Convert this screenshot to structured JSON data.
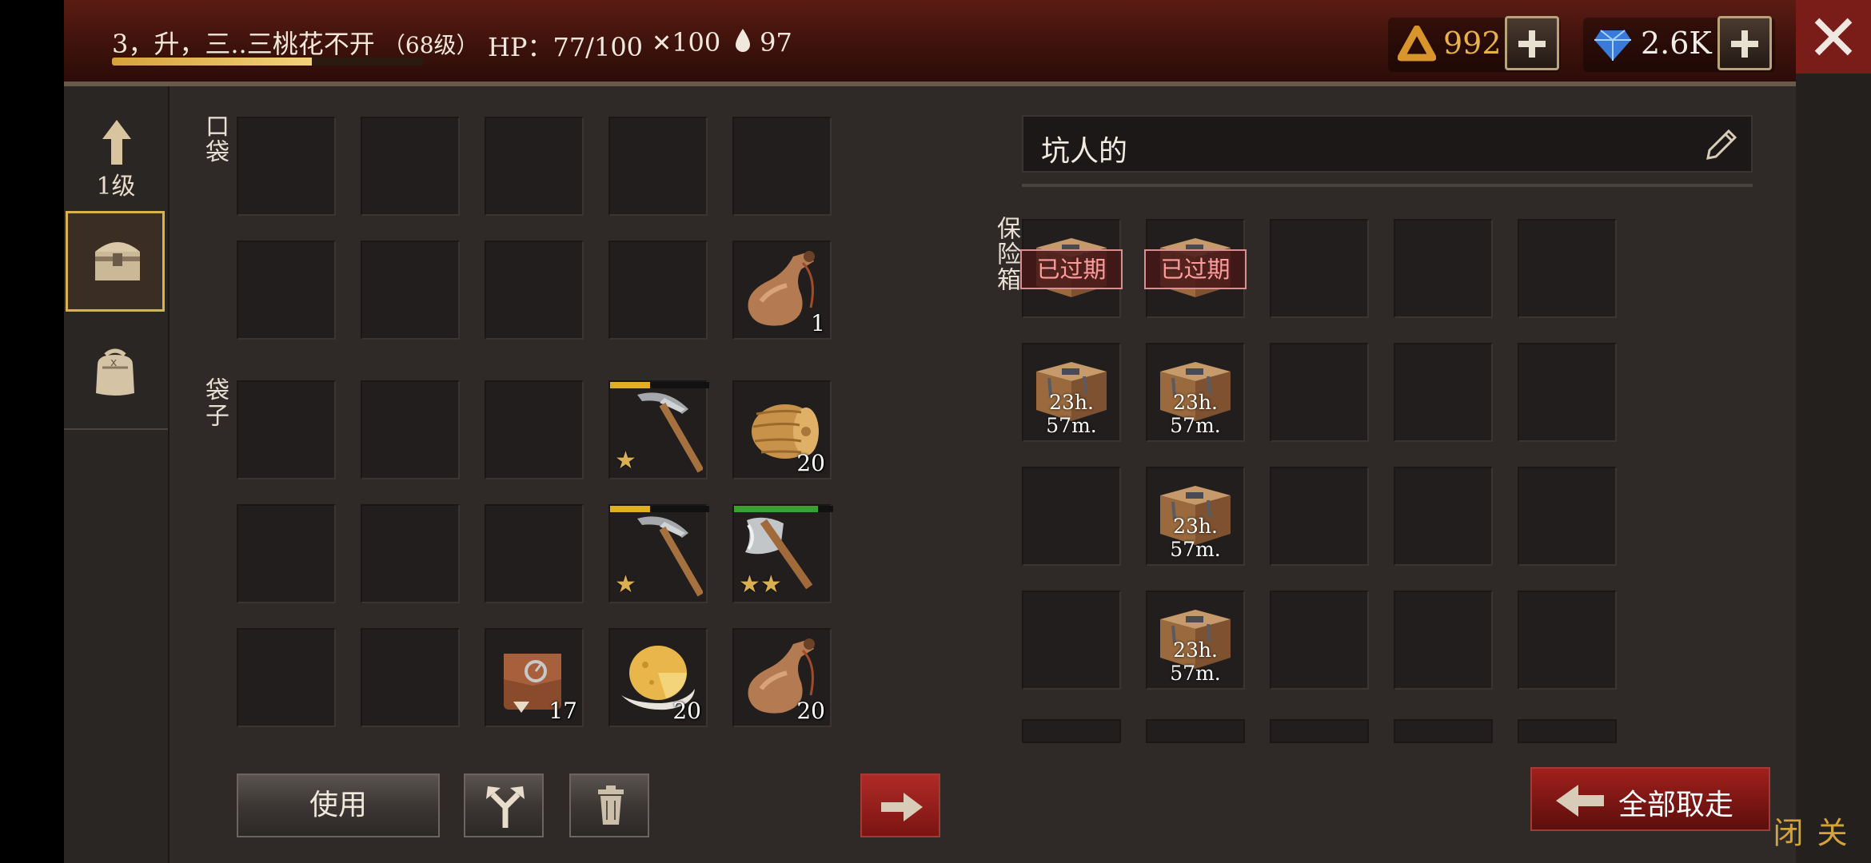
{
  "header": {
    "player_name": "3，升，三..三桃花不开",
    "player_level": "（68级）",
    "hp_label": "HP：",
    "hp_value": "77/100",
    "attack_value": "100",
    "water_value": "97",
    "xp_progress_fraction": 0.64,
    "currency_coins": "992",
    "currency_gems": "2.6K"
  },
  "sidebar": {
    "upgrade_level": "1级",
    "tabs": [
      {
        "icon": "chest-icon",
        "selected": true
      },
      {
        "icon": "backpack-icon",
        "selected": false
      }
    ]
  },
  "left_panel": {
    "pocket_label": "口袋",
    "bag_label": "袋子",
    "pocket_slots": [
      {
        "item": ""
      },
      {
        "item": ""
      },
      {
        "item": ""
      },
      {
        "item": ""
      },
      {
        "item": ""
      },
      {
        "item": ""
      },
      {
        "item": ""
      },
      {
        "item": ""
      },
      {
        "item": ""
      },
      {
        "item": "flask-icon",
        "count": "1"
      }
    ],
    "bag_slots": [
      {
        "item": ""
      },
      {
        "item": ""
      },
      {
        "item": ""
      },
      {
        "item": "pickaxe-icon",
        "stars": "★",
        "durability": 0.4
      },
      {
        "item": "hay-bale-icon",
        "count": "20"
      },
      {
        "item": ""
      },
      {
        "item": ""
      },
      {
        "item": ""
      },
      {
        "item": "pickaxe-icon",
        "stars": "★",
        "durability": 0.4
      },
      {
        "item": "axe-icon",
        "stars": "★★",
        "durability": 0.85
      },
      {
        "item": ""
      },
      {
        "item": ""
      },
      {
        "item": "leather-bag-icon",
        "count": "17"
      },
      {
        "item": "cheese-icon",
        "count": "20"
      },
      {
        "item": "flask-icon",
        "count": "20"
      }
    ]
  },
  "right_panel": {
    "container_name": "坑人的",
    "safe_label": "保险箱",
    "slots": [
      {
        "item": "crate-icon",
        "expired": "已过期"
      },
      {
        "item": "crate-icon",
        "expired": "已过期"
      },
      {
        "item": ""
      },
      {
        "item": ""
      },
      {
        "item": ""
      },
      {
        "item": "crate-icon",
        "timer": "23h. 57m."
      },
      {
        "item": "crate-icon",
        "timer": "23h. 57m."
      },
      {
        "item": ""
      },
      {
        "item": ""
      },
      {
        "item": ""
      },
      {
        "item": ""
      },
      {
        "item": "crate-icon",
        "timer": "23h. 57m."
      },
      {
        "item": ""
      },
      {
        "item": ""
      },
      {
        "item": ""
      },
      {
        "item": ""
      },
      {
        "item": "crate-icon",
        "timer": "23h. 57m."
      },
      {
        "item": ""
      },
      {
        "item": ""
      },
      {
        "item": ""
      }
    ]
  },
  "buttons": {
    "use_label": "使用",
    "take_all_label": "全部取走",
    "close_label": "关闭"
  },
  "colors": {
    "accent_gold": "#d9b24a",
    "danger_red": "#a0201c",
    "expired_text": "#ff9d9d"
  }
}
